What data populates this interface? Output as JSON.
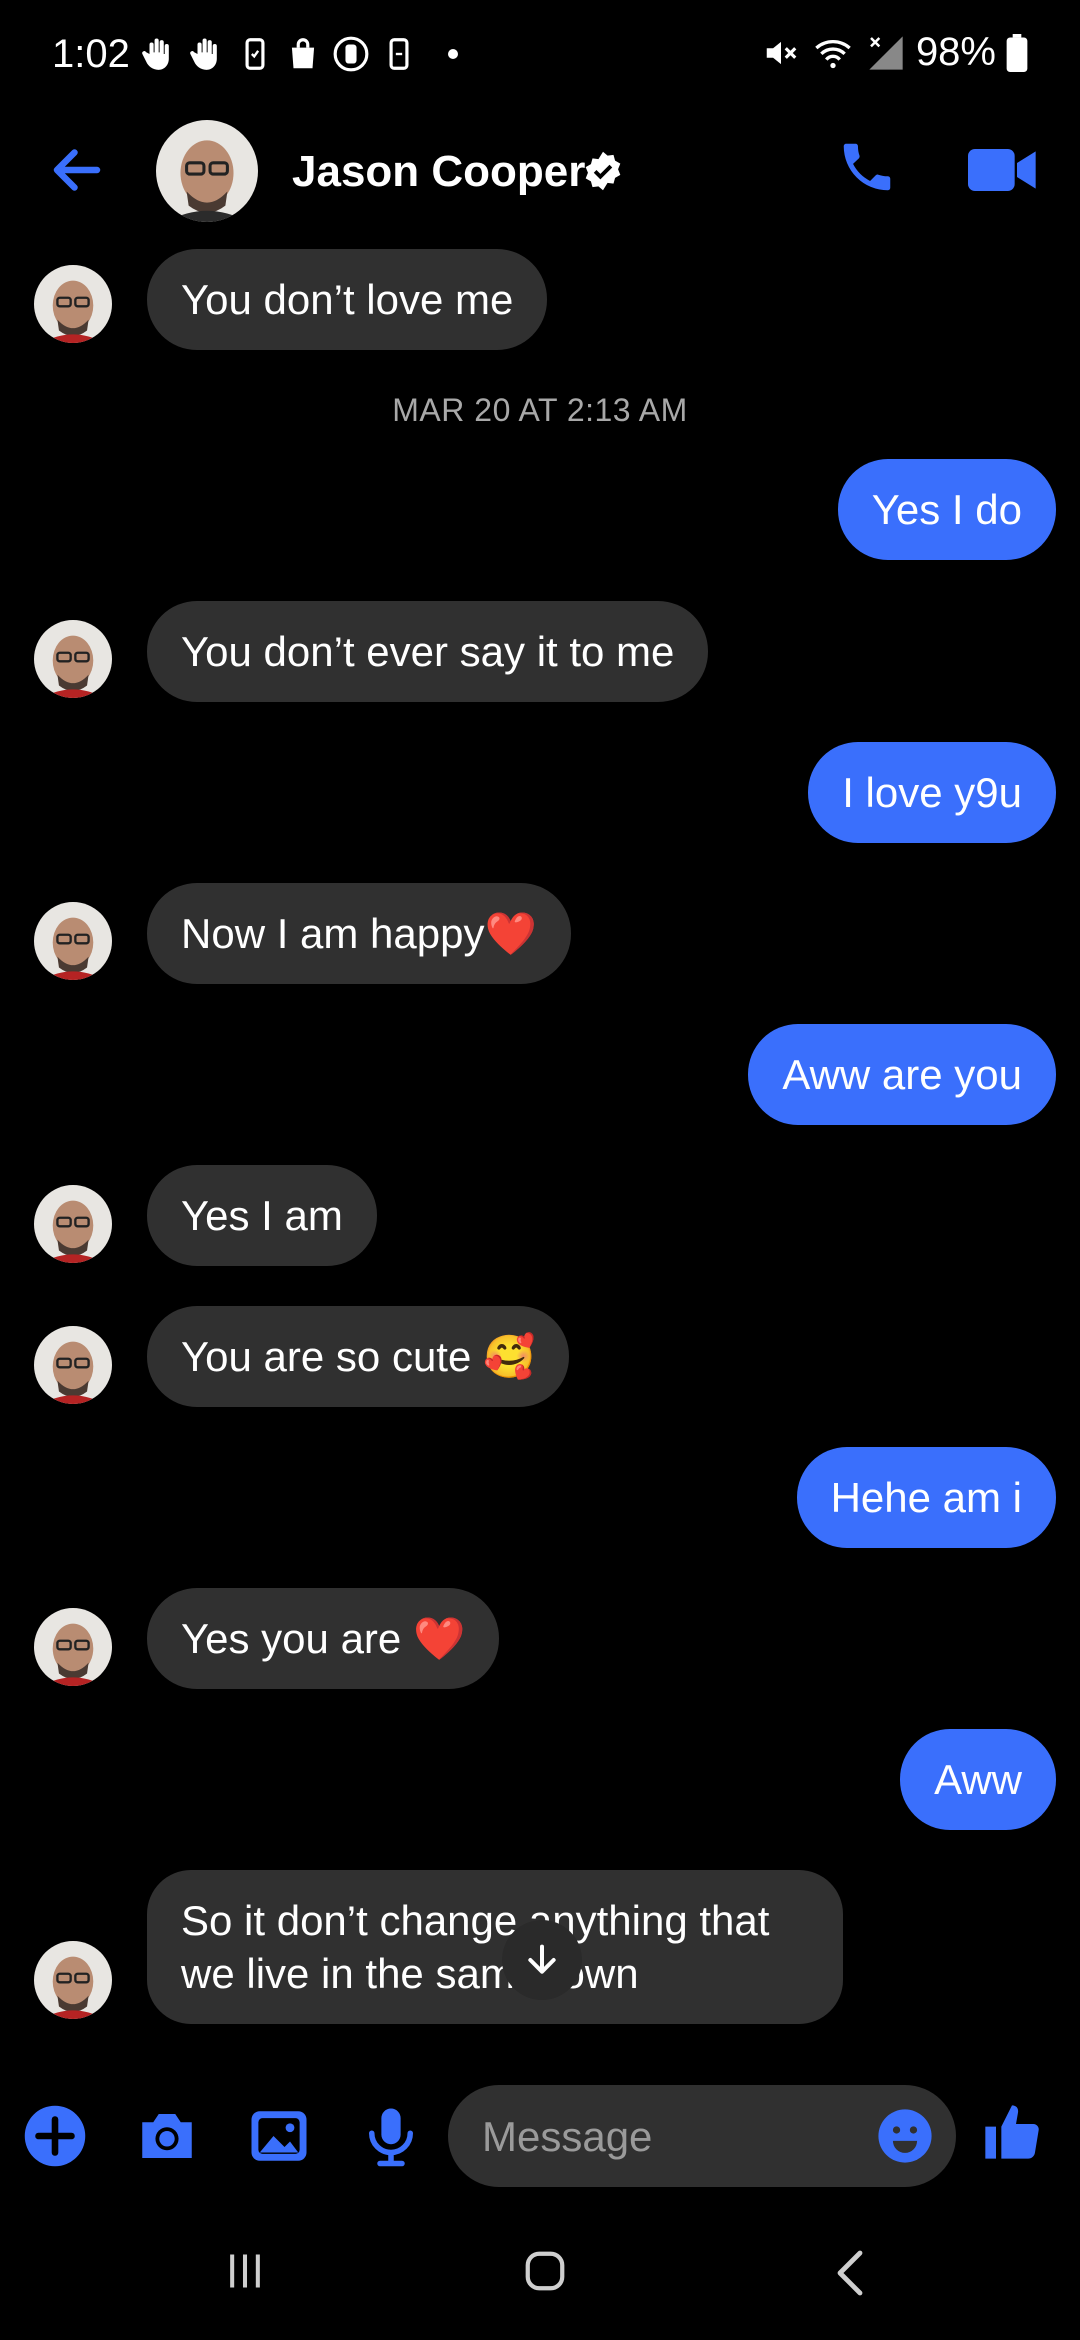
{
  "status_bar": {
    "time": "1:02",
    "battery": "98%"
  },
  "header": {
    "contact_name": "Jason Cooper",
    "icons": [
      "back-arrow-icon",
      "verified-icon",
      "phone-icon",
      "video-camera-icon"
    ]
  },
  "thread": {
    "messages": [
      {
        "dir": "in",
        "text": "You don’t love me"
      },
      {
        "dir": "stamp",
        "text": "MAR 20 AT 2:13 AM"
      },
      {
        "dir": "out",
        "text": "Yes I do"
      },
      {
        "dir": "in",
        "text": "You don’t ever say it to me"
      },
      {
        "dir": "out",
        "text": "I love y9u"
      },
      {
        "dir": "in",
        "text": "Now I am happy❤️"
      },
      {
        "dir": "out",
        "text": "Aww are you"
      },
      {
        "dir": "in",
        "text": "Yes I am"
      },
      {
        "dir": "in",
        "text": "You are so cute 🥰"
      },
      {
        "dir": "out",
        "text": "Hehe am i"
      },
      {
        "dir": "in",
        "text": "Yes you are ❤️"
      },
      {
        "dir": "out",
        "text": "Aww"
      },
      {
        "dir": "in",
        "text": "So it don’t change anything that we live in the same town"
      }
    ]
  },
  "composer": {
    "placeholder": "Message",
    "icons": [
      "plus-icon",
      "camera-icon",
      "gallery-icon",
      "microphone-icon",
      "emoji-icon",
      "thumbs-up-icon"
    ]
  },
  "colors": {
    "accent": "#3a6ffc",
    "incoming_bubble": "#303030",
    "background": "#000000"
  }
}
